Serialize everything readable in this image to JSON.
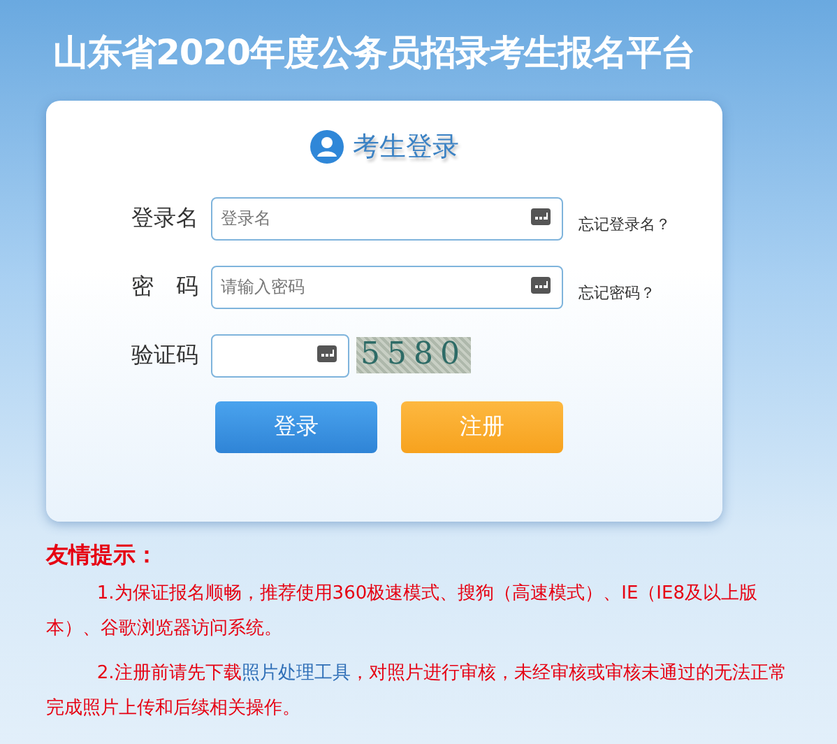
{
  "header": {
    "title": "山东省2020年度公务员招录考生报名平台"
  },
  "login": {
    "heading": "考生登录",
    "fields": [
      {
        "kind": "text",
        "label": "登录名",
        "placeholder": "登录名",
        "link": "忘记登录名？"
      },
      {
        "kind": "password",
        "label": "密　码",
        "placeholder": "请输入密码",
        "link": "忘记密码？"
      },
      {
        "kind": "captcha",
        "label": "验证码",
        "captcha": "5580"
      }
    ],
    "buttons": [
      {
        "kind": "primary",
        "label": "登录"
      },
      {
        "kind": "secondary",
        "label": "注册"
      }
    ]
  },
  "tips": {
    "title": "友情提示：",
    "paragraphs": [
      [
        {
          "kind": "text",
          "text": "1.为保证报名顺畅，推荐使用360极速模式、搜狗（高速模式）、IE（IE8及以上版本）、谷歌浏览器访问系统。"
        }
      ],
      [
        {
          "kind": "text",
          "text": "2.注册前请先下载"
        },
        {
          "kind": "link",
          "text": "照片处理工具"
        },
        {
          "kind": "text",
          "text": "，对照片进行审核，未经审核或审核未通过的无法正常完成照片上传和后续相关操作。"
        }
      ]
    ]
  }
}
